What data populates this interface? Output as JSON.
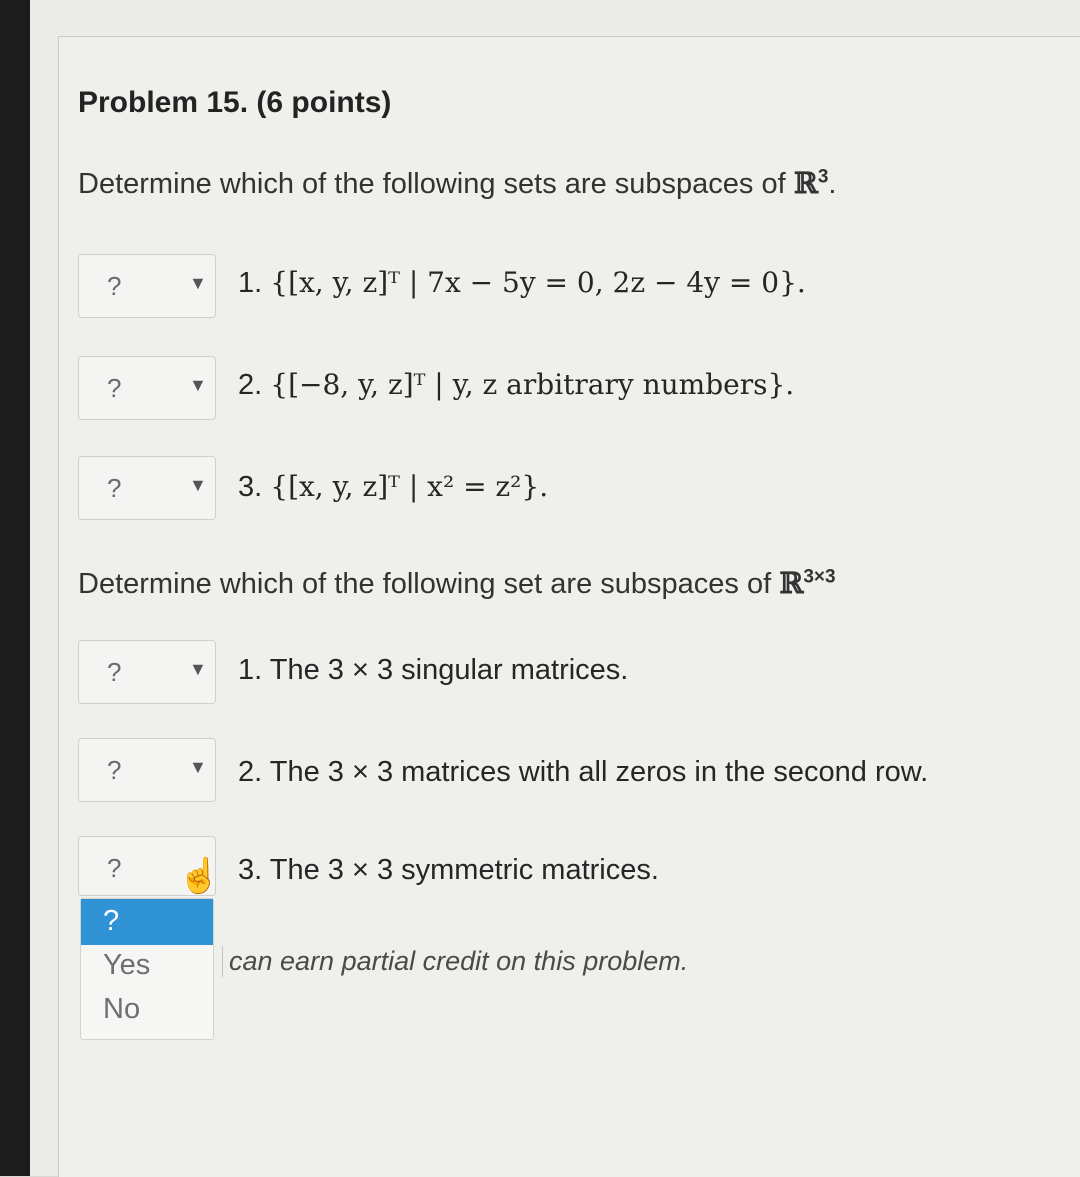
{
  "problem": {
    "title": "Problem 15. (6 points)"
  },
  "part1": {
    "prompt": "Determine which of the following sets are subspaces of ",
    "space_symbol": "ℝ",
    "space_exp": "3",
    "items": [
      {
        "selected": "?",
        "number": "1.",
        "expression": "{[x, y, z]ᵀ | 7x − 5y = 0, 2z − 4y = 0}."
      },
      {
        "selected": "?",
        "number": "2.",
        "expression": "{[−8, y, z]ᵀ | y, z arbitrary numbers}."
      },
      {
        "selected": "?",
        "number": "3.",
        "expression": "{[x, y, z]ᵀ | x² = z²}."
      }
    ]
  },
  "part2": {
    "prompt": "Determine which of the following set are subspaces of ",
    "space_symbol": "ℝ",
    "space_exp": "3×3",
    "items": [
      {
        "selected": "?",
        "number": "1.",
        "text": "The 3 × 3 singular matrices."
      },
      {
        "selected": "?",
        "number": "2.",
        "text": "The 3 × 3 matrices with all zeros in the second row."
      },
      {
        "selected": "?",
        "number": "3.",
        "text": "The 3 × 3 symmetric matrices."
      }
    ]
  },
  "dropdown_options": [
    "?",
    "Yes",
    "No"
  ],
  "partial_credit_note": "can earn partial credit on this problem.",
  "colors": {
    "highlight": "#2f93d6"
  }
}
